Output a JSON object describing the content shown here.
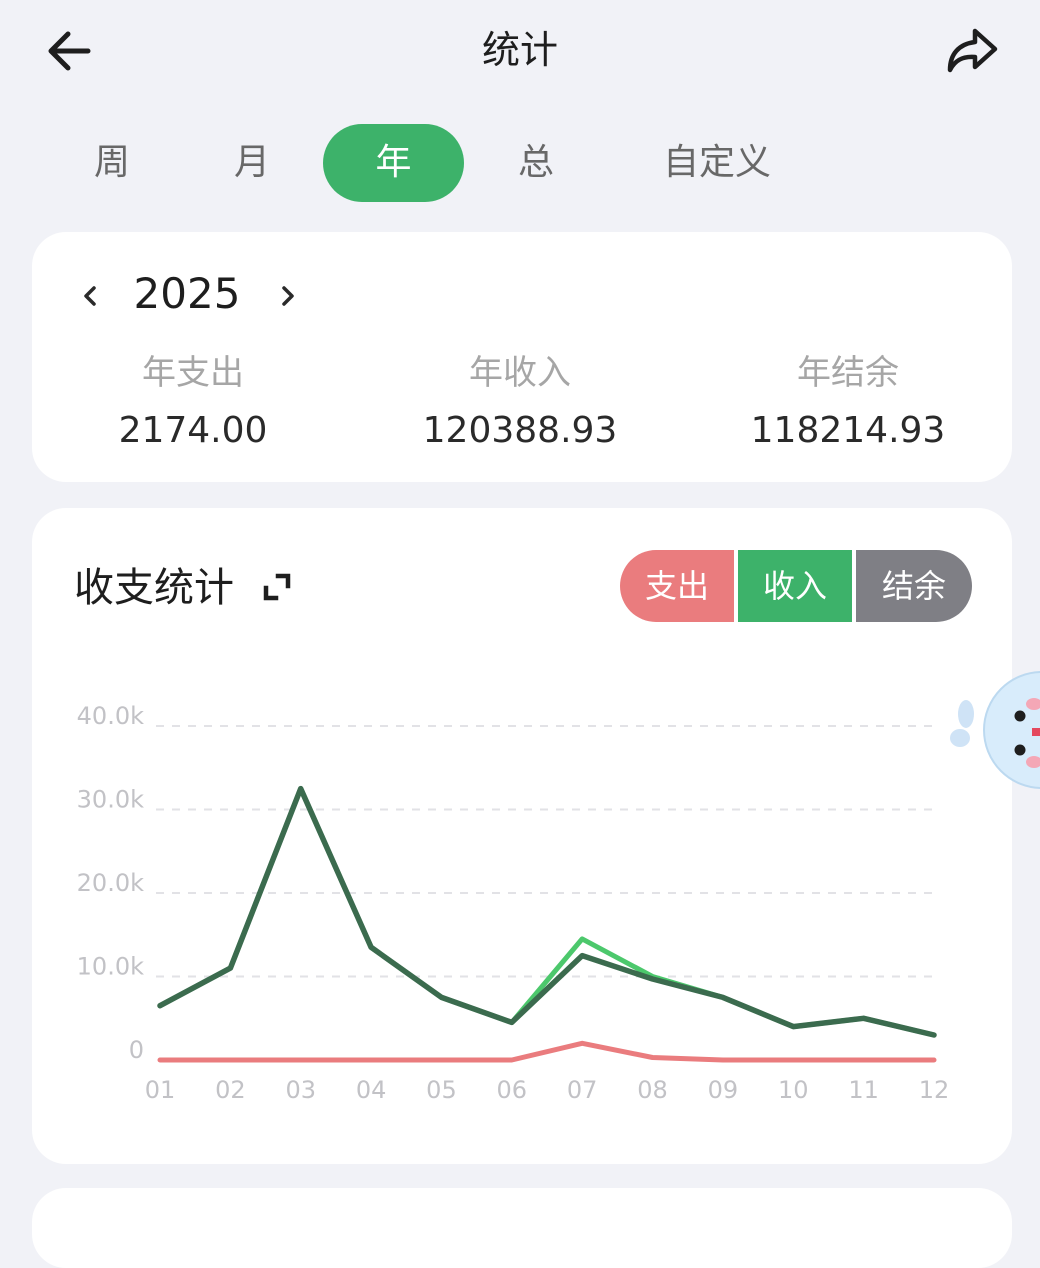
{
  "header": {
    "title": "统计",
    "back_icon": "arrow-left-icon",
    "share_icon": "share-icon"
  },
  "tabs": [
    {
      "label": "周",
      "active": false
    },
    {
      "label": "月",
      "active": false
    },
    {
      "label": "年",
      "active": true
    },
    {
      "label": "总",
      "active": false
    },
    {
      "label": "自定义",
      "active": false
    }
  ],
  "summary": {
    "prev_icon": "chevron-left-icon",
    "next_icon": "chevron-right-icon",
    "year": "2025",
    "expense_label": "年支出",
    "expense_value": "2174.00",
    "income_label": "年收入",
    "income_value": "120388.93",
    "balance_label": "年结余",
    "balance_value": "118214.93"
  },
  "chart_card": {
    "title": "收支统计",
    "expand_icon": "expand-icon",
    "segments": {
      "expense": "支出",
      "income": "收入",
      "balance": "结余"
    }
  },
  "colors": {
    "accent": "#3db26a",
    "expense": "#ea7c7e",
    "income": "#4cc86c",
    "balance": "#7a7a80",
    "balance_line": "#3b6b4e"
  },
  "chart_data": {
    "type": "line",
    "x": [
      "01",
      "02",
      "03",
      "04",
      "05",
      "06",
      "07",
      "08",
      "09",
      "10",
      "11",
      "12"
    ],
    "y_ticks": [
      "0",
      "10.0k",
      "20.0k",
      "30.0k",
      "40.0k"
    ],
    "ylim": [
      0,
      40000
    ],
    "grid": true,
    "series": [
      {
        "name": "支出",
        "color": "#ea7c7e",
        "values": [
          0,
          0,
          0,
          0,
          0,
          0,
          2000,
          300,
          0,
          0,
          0,
          0
        ]
      },
      {
        "name": "收入",
        "color": "#4cc86c",
        "values": [
          6500,
          11000,
          32500,
          13500,
          7500,
          4500,
          14500,
          10000,
          7500,
          4000,
          5000,
          3000
        ]
      },
      {
        "name": "结余",
        "color": "#3b6b4e",
        "values": [
          6500,
          11000,
          32500,
          13500,
          7500,
          4500,
          12500,
          9700,
          7500,
          4000,
          5000,
          3000
        ]
      }
    ]
  }
}
